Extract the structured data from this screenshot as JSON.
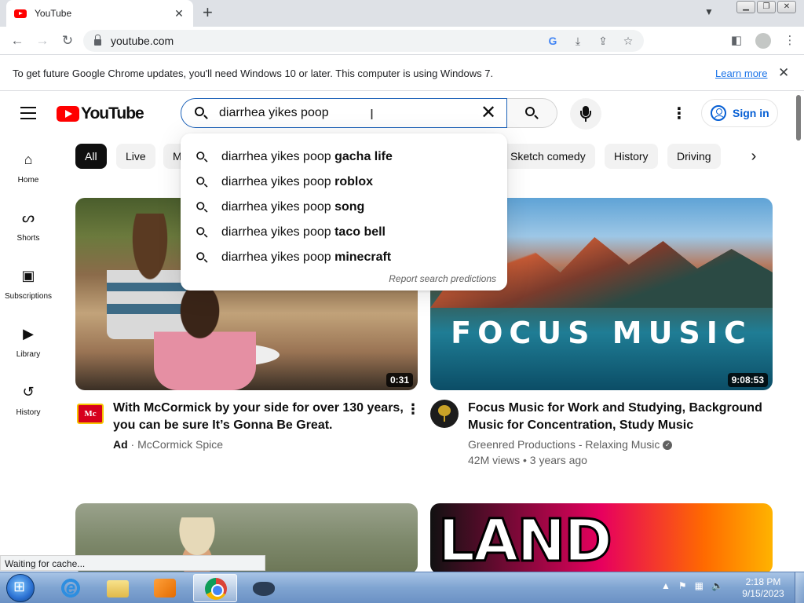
{
  "browser": {
    "tab_title": "YouTube",
    "url": "youtube.com",
    "tab_close": "✕",
    "new_tab": "+"
  },
  "infobar": {
    "message": "To get future Google Chrome updates, you'll need Windows 10 or later. This computer is using Windows 7.",
    "link": "Learn more"
  },
  "youtube": {
    "logo_text": "YouTube",
    "search_value": "diarrhea yikes poop",
    "sign_in": "Sign in",
    "sidebar": [
      {
        "label": "Home",
        "icon": "home-icon"
      },
      {
        "label": "Shorts",
        "icon": "shorts-icon"
      },
      {
        "label": "Subscriptions",
        "icon": "subscriptions-icon"
      },
      {
        "label": "Library",
        "icon": "library-icon"
      },
      {
        "label": "History",
        "icon": "history-icon"
      }
    ],
    "chips": [
      "All",
      "Live",
      "M",
      "Sketch comedy",
      "History",
      "Driving"
    ],
    "suggestions": [
      {
        "prefix": "diarrhea yikes poop ",
        "suffix": "gacha life"
      },
      {
        "prefix": "diarrhea yikes poop ",
        "suffix": "roblox"
      },
      {
        "prefix": "diarrhea yikes poop ",
        "suffix": "song"
      },
      {
        "prefix": "diarrhea yikes poop ",
        "suffix": "taco bell"
      },
      {
        "prefix": "diarrhea yikes poop ",
        "suffix": "minecraft"
      }
    ],
    "report_predictions": "Report search predictions",
    "videos": [
      {
        "title_line1": "With McCormick by your side for over 130 years,",
        "title_line2": "you can be sure It’s Gonna Be Great.",
        "ad_label": "Ad",
        "channel": "McCormick Spice",
        "duration": "0:31",
        "avatar_text": "Mc"
      },
      {
        "title_line1": "Focus Music for Work and Studying, Background",
        "title_line2": "Music for Concentration, Study Music",
        "channel": "Greenred Productions - Relaxing Music",
        "stats": "42M views • 3 years ago",
        "duration": "9:08:53",
        "thumb_text": "FOCUS MUSIC"
      },
      {
        "title_line1": "",
        "thumb_text": ""
      },
      {
        "title_line1": "",
        "thumb_text": "LAND"
      }
    ]
  },
  "status": "Waiting for cache...",
  "taskbar": {
    "time": "2:18 PM",
    "date": "9/15/2023"
  },
  "colors": {
    "yt_red": "#ff0000",
    "link_blue": "#065fd4",
    "chrome_link": "#1a73e8",
    "taskbar": "#7fa4d1"
  }
}
